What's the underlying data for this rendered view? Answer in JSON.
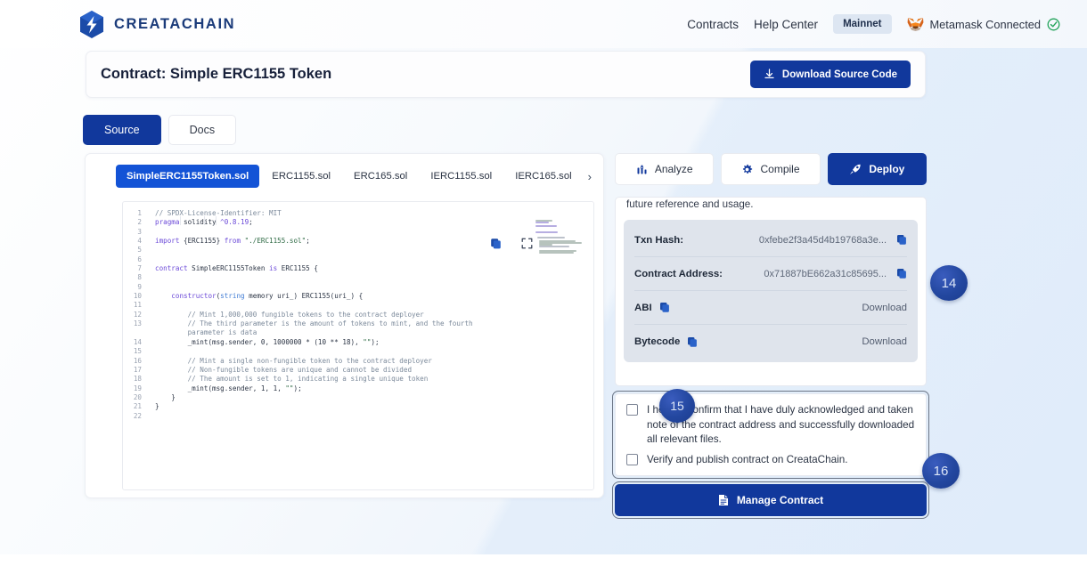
{
  "header": {
    "brand": "CREATACHAIN",
    "logo_icon": "creatachain-logo-icon",
    "nav": [
      {
        "label": "Contracts",
        "name": "nav-link-contracts"
      },
      {
        "label": "Help Center",
        "name": "nav-link-help-center"
      }
    ],
    "network_chip": "Mainnet",
    "wallet": {
      "icon": "metamask-fox-icon",
      "label": "Metamask Connected",
      "status_icon": "check-circle-icon"
    }
  },
  "title_card": {
    "title": "Contract: Simple ERC1155 Token",
    "download_button": "Download Source Code",
    "download_icon": "download-icon"
  },
  "view_tabs": [
    {
      "label": "Source",
      "active": true
    },
    {
      "label": "Docs",
      "active": false
    }
  ],
  "file_tabs": [
    {
      "label": "SimpleERC1155Token.sol",
      "active": true
    },
    {
      "label": "ERC1155.sol",
      "active": false
    },
    {
      "label": "ERC165.sol",
      "active": false
    },
    {
      "label": "IERC1155.sol",
      "active": false
    },
    {
      "label": "IERC165.sol",
      "active": false
    }
  ],
  "file_tabs_next_icon": "chevron-right-icon",
  "editor": {
    "copy_icon": "copy-icon",
    "expand_icon": "expand-icon",
    "minimap_icon": "code-minimap",
    "lines": [
      {
        "n": "1",
        "segments": [
          {
            "t": "// SPDX-License-Identifier: MIT",
            "c": "com"
          }
        ]
      },
      {
        "n": "2",
        "segments": [
          {
            "t": "pragma",
            "c": "kw"
          },
          {
            "t": " solidity ",
            "c": "pln"
          },
          {
            "t": "^0.8.19",
            "c": "kw"
          },
          {
            "t": ";",
            "c": "pln"
          }
        ]
      },
      {
        "n": "3",
        "segments": []
      },
      {
        "n": "4",
        "segments": [
          {
            "t": "import",
            "c": "kw"
          },
          {
            "t": " {ERC1155} ",
            "c": "pln"
          },
          {
            "t": "from",
            "c": "kw"
          },
          {
            "t": " ",
            "c": "pln"
          },
          {
            "t": "\"./ERC1155.sol\"",
            "c": "str"
          },
          {
            "t": ";",
            "c": "pln"
          }
        ]
      },
      {
        "n": "5",
        "segments": []
      },
      {
        "n": "6",
        "segments": []
      },
      {
        "n": "7",
        "segments": [
          {
            "t": "contract",
            "c": "kw"
          },
          {
            "t": " SimpleERC1155Token ",
            "c": "pln"
          },
          {
            "t": "is",
            "c": "kw"
          },
          {
            "t": " ERC1155 {",
            "c": "pln"
          }
        ]
      },
      {
        "n": "8",
        "segments": []
      },
      {
        "n": "9",
        "segments": []
      },
      {
        "n": "10",
        "segments": [
          {
            "t": "    ",
            "c": "pln"
          },
          {
            "t": "constructor",
            "c": "kw"
          },
          {
            "t": "(",
            "c": "pln"
          },
          {
            "t": "string",
            "c": "typ"
          },
          {
            "t": " memory uri_) ERC1155(uri_) {",
            "c": "pln"
          }
        ]
      },
      {
        "n": "11",
        "segments": []
      },
      {
        "n": "12",
        "segments": [
          {
            "t": "        // Mint 1,000,000 fungible tokens to the contract deployer",
            "c": "com"
          }
        ]
      },
      {
        "n": "13",
        "segments": [
          {
            "t": "        // The third parameter is the amount of tokens to mint, and the fourth",
            "c": "com"
          }
        ]
      },
      {
        "n": "",
        "segments": [
          {
            "t": "        parameter is data",
            "c": "com"
          }
        ]
      },
      {
        "n": "14",
        "segments": [
          {
            "t": "        _mint",
            "c": "pln"
          },
          {
            "t": "(msg.sender, ",
            "c": "pln"
          },
          {
            "t": "0",
            "c": "num"
          },
          {
            "t": ", ",
            "c": "pln"
          },
          {
            "t": "1000000",
            "c": "num"
          },
          {
            "t": " * (",
            "c": "pln"
          },
          {
            "t": "10",
            "c": "num"
          },
          {
            "t": " ** ",
            "c": "pln"
          },
          {
            "t": "18",
            "c": "num"
          },
          {
            "t": "), ",
            "c": "pln"
          },
          {
            "t": "\"\"",
            "c": "str"
          },
          {
            "t": ");",
            "c": "pln"
          }
        ]
      },
      {
        "n": "15",
        "segments": []
      },
      {
        "n": "16",
        "segments": [
          {
            "t": "        // Mint a single non-fungible token to the contract deployer",
            "c": "com"
          }
        ]
      },
      {
        "n": "17",
        "segments": [
          {
            "t": "        // Non-fungible tokens are unique and cannot be divided",
            "c": "com"
          }
        ]
      },
      {
        "n": "18",
        "segments": [
          {
            "t": "        // The amount is set to 1, indicating a single unique token",
            "c": "com"
          }
        ]
      },
      {
        "n": "19",
        "segments": [
          {
            "t": "        _mint",
            "c": "pln"
          },
          {
            "t": "(msg.sender, ",
            "c": "pln"
          },
          {
            "t": "1",
            "c": "num"
          },
          {
            "t": ", ",
            "c": "pln"
          },
          {
            "t": "1",
            "c": "num"
          },
          {
            "t": ", ",
            "c": "pln"
          },
          {
            "t": "\"\"",
            "c": "str"
          },
          {
            "t": ");",
            "c": "pln"
          }
        ]
      },
      {
        "n": "20",
        "segments": [
          {
            "t": "    }",
            "c": "pln"
          }
        ]
      },
      {
        "n": "21",
        "segments": [
          {
            "t": "}",
            "c": "pln"
          }
        ]
      },
      {
        "n": "22",
        "segments": []
      }
    ]
  },
  "actions": [
    {
      "label": "Analyze",
      "icon": "analyze-icon",
      "primary": false
    },
    {
      "label": "Compile",
      "icon": "gear-icon",
      "primary": false
    },
    {
      "label": "Deploy",
      "icon": "rocket-icon",
      "primary": true
    }
  ],
  "deploy_panel": {
    "intro_text": "future reference and usage.",
    "rows": [
      {
        "label": "Txn Hash:",
        "value": "0xfebe2f3a45d4b19768a3e...",
        "copy_icon": "copy-icon",
        "kind": "value"
      },
      {
        "label": "Contract Address:",
        "value": "0x71887bE662a31c85695...",
        "copy_icon": "copy-icon",
        "kind": "value"
      },
      {
        "label": "ABI",
        "value": "Download",
        "copy_icon": "copy-icon",
        "kind": "download"
      },
      {
        "label": "Bytecode",
        "value": "Download",
        "copy_icon": "copy-icon",
        "kind": "download"
      }
    ]
  },
  "confirmations": [
    {
      "label": "I hereby confirm that I have duly acknowledged and taken note of the contract address and successfully downloaded all relevant files.",
      "checked": false
    },
    {
      "label": "Verify and publish contract on CreataChain.",
      "checked": false
    }
  ],
  "manage_button": {
    "label": "Manage Contract",
    "icon": "document-icon"
  },
  "callouts": [
    {
      "number": "14",
      "name": "callout-badge-14"
    },
    {
      "number": "15",
      "name": "callout-badge-15"
    },
    {
      "number": "16",
      "name": "callout-badge-16"
    }
  ],
  "colors": {
    "primary": "#11389c",
    "tab_active": "#1353d6",
    "info_box": "#dfe4ec",
    "badge": "#23479f"
  }
}
